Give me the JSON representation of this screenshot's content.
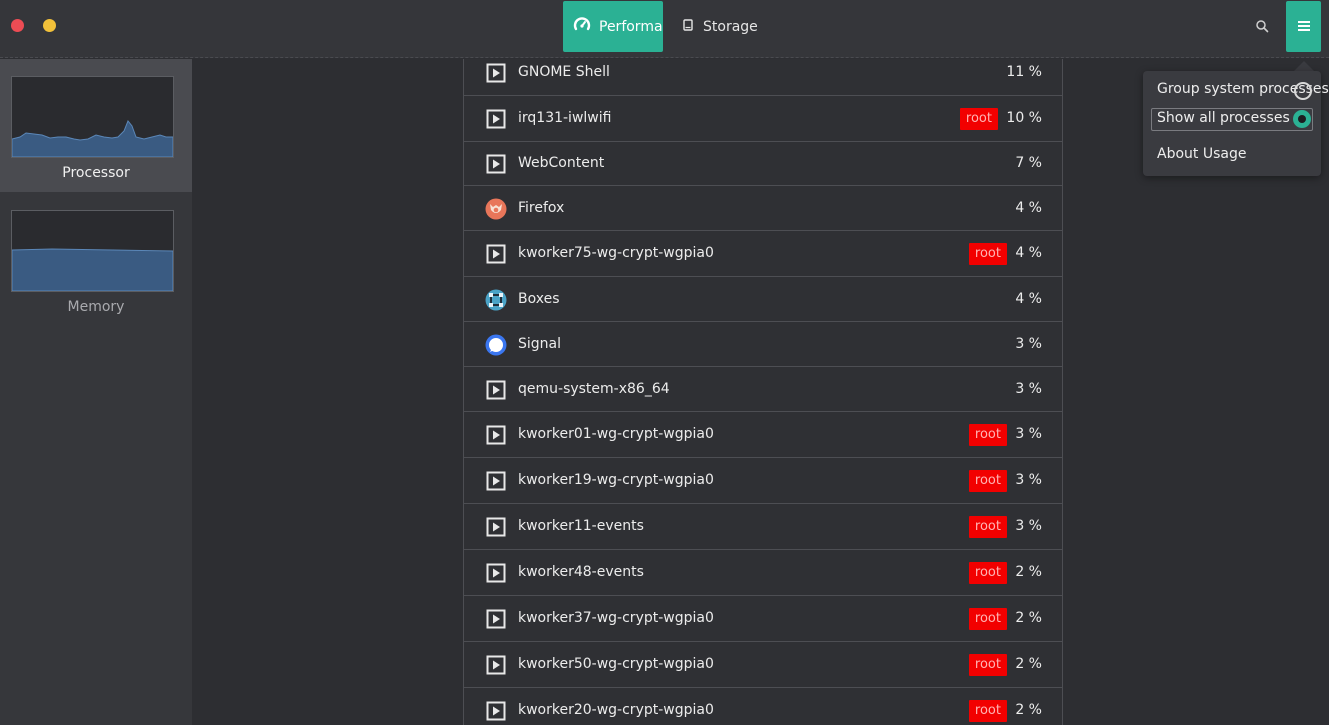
{
  "window": {
    "controls": [
      "close",
      "minimize"
    ]
  },
  "header": {
    "tabs": [
      {
        "label": "Performa",
        "icon": "gauge-icon",
        "active": true
      },
      {
        "label": "Storage",
        "icon": "drive-icon",
        "active": false
      }
    ],
    "search_icon": "search-icon",
    "menu_icon": "hamburger-menu-icon",
    "accent_color": "#2bb194"
  },
  "sidebar": {
    "items": [
      {
        "label": "Processor",
        "selected": true
      },
      {
        "label": "Memory",
        "selected": false
      }
    ]
  },
  "processes": [
    {
      "name": "GNOME Shell",
      "icon": "terminal-icon",
      "root": false,
      "cpu": "11 %"
    },
    {
      "name": "irq131-iwlwifi",
      "icon": "terminal-icon",
      "root": true,
      "cpu": "10 %"
    },
    {
      "name": "WebContent",
      "icon": "terminal-icon",
      "root": false,
      "cpu": "7 %"
    },
    {
      "name": "Firefox",
      "icon": "firefox-icon",
      "root": false,
      "cpu": "4 %"
    },
    {
      "name": "kworker75-wg-crypt-wgpia0",
      "icon": "terminal-icon",
      "root": true,
      "cpu": "4 %"
    },
    {
      "name": "Boxes",
      "icon": "boxes-icon",
      "root": false,
      "cpu": "4 %"
    },
    {
      "name": "Signal",
      "icon": "signal-icon",
      "root": false,
      "cpu": "3 %"
    },
    {
      "name": "qemu-system-x86_64",
      "icon": "terminal-icon",
      "root": false,
      "cpu": "3 %"
    },
    {
      "name": "kworker01-wg-crypt-wgpia0",
      "icon": "terminal-icon",
      "root": true,
      "cpu": "3 %"
    },
    {
      "name": "kworker19-wg-crypt-wgpia0",
      "icon": "terminal-icon",
      "root": true,
      "cpu": "3 %"
    },
    {
      "name": "kworker11-events",
      "icon": "terminal-icon",
      "root": true,
      "cpu": "3 %"
    },
    {
      "name": "kworker48-events",
      "icon": "terminal-icon",
      "root": true,
      "cpu": "2 %"
    },
    {
      "name": "kworker37-wg-crypt-wgpia0",
      "icon": "terminal-icon",
      "root": true,
      "cpu": "2 %"
    },
    {
      "name": "kworker50-wg-crypt-wgpia0",
      "icon": "terminal-icon",
      "root": true,
      "cpu": "2 %"
    },
    {
      "name": "kworker20-wg-crypt-wgpia0",
      "icon": "terminal-icon",
      "root": true,
      "cpu": "2 %"
    }
  ],
  "root_badge": {
    "label": "root",
    "color": "#f20000"
  },
  "menu": {
    "group_label": "Group system processes",
    "group_checked": false,
    "show_all_label": "Show all processes",
    "show_all_checked": true,
    "about_label": "About Usage"
  }
}
